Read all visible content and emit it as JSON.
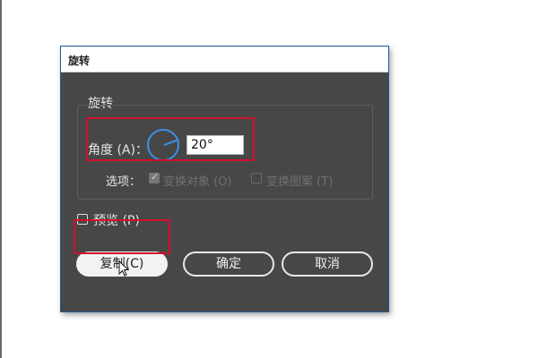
{
  "dialog": {
    "title": "旋转",
    "group_label": "旋转",
    "angle": {
      "label": "角度 (A)：",
      "value": "20°",
      "dial_degrees": 20
    },
    "options": {
      "label": "选项：",
      "transform_objects": {
        "label": "变换对象 (O)",
        "checked": true
      },
      "transform_patterns": {
        "label": "变换图案 (T)",
        "checked": false
      }
    },
    "preview": {
      "label": "预览 (P)",
      "checked": false
    },
    "buttons": {
      "copy": "复制(C)",
      "ok": "确定",
      "cancel": "取消"
    }
  },
  "colors": {
    "dialog_bg": "#474747",
    "dial_accent": "#3d90e8",
    "highlight": "#d0102c",
    "title_bar": "#ffffff"
  },
  "icons": [
    "rotation-dial-icon",
    "checkbox-icon",
    "mouse-pointer-icon"
  ]
}
